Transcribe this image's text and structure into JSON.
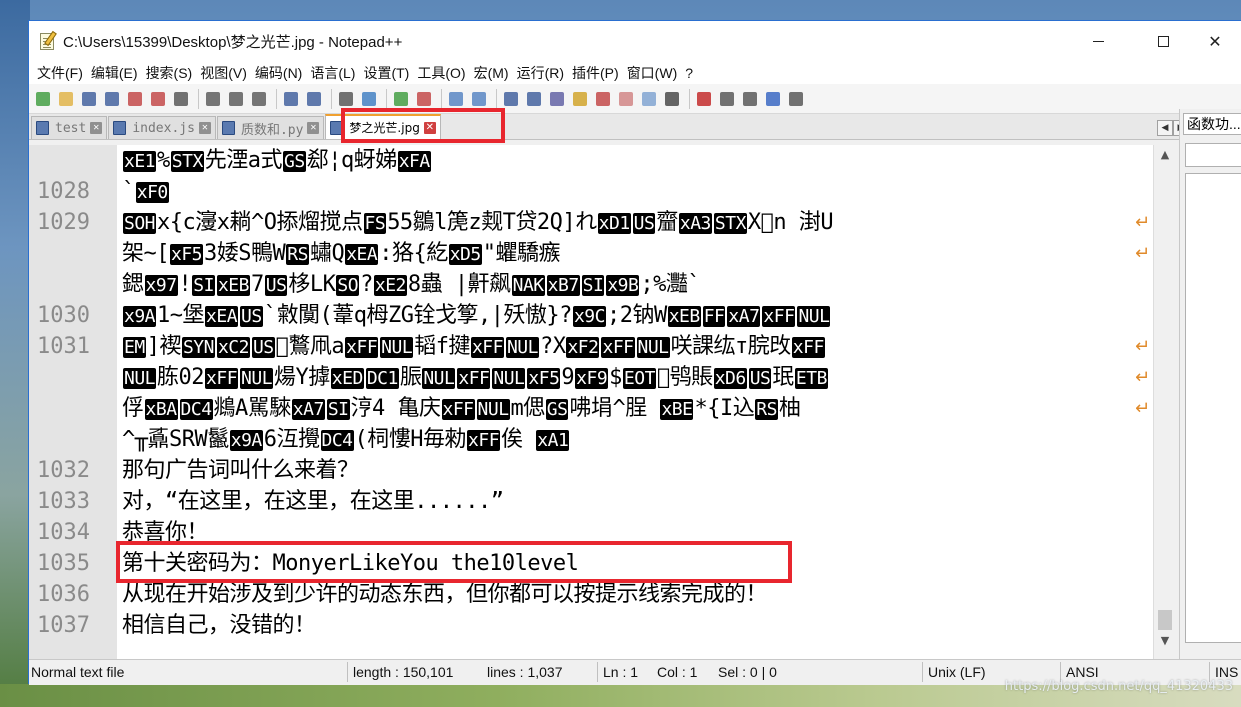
{
  "window": {
    "title": "C:\\Users\\15399\\Desktop\\梦之光芒.jpg - Notepad++",
    "minimize": "—",
    "close": "✕"
  },
  "menu": [
    "文件(F)",
    "编辑(E)",
    "搜索(S)",
    "视图(V)",
    "编码(N)",
    "语言(L)",
    "设置(T)",
    "工具(O)",
    "宏(M)",
    "运行(R)",
    "插件(P)",
    "窗口(W)",
    "?"
  ],
  "toolbar_icons": [
    "new-file-icon",
    "open-file-icon",
    "save-icon",
    "save-all-icon",
    "close-icon",
    "close-all-icon",
    "print-icon",
    "cut-icon",
    "copy-icon",
    "paste-icon",
    "undo-icon",
    "redo-icon",
    "find-icon",
    "replace-icon",
    "zoom-in-icon",
    "zoom-out-icon",
    "sync-v-icon",
    "sync-h-icon",
    "word-wrap-icon",
    "show-all-chars-icon",
    "indent-guide-icon",
    "doc-map-icon",
    "function-list-icon",
    "folder-workspace-icon",
    "doc-list-icon",
    "monitor-icon",
    "record-macro-icon",
    "stop-macro-icon",
    "play-macro-icon",
    "run-multiple-macro-icon",
    "save-macro-icon"
  ],
  "tabs": [
    {
      "label": "test",
      "active": false
    },
    {
      "label": "index.js",
      "active": false
    },
    {
      "label": "质数和.py",
      "active": false
    },
    {
      "label": "梦之光芒.jpg",
      "active": true
    }
  ],
  "side_panel": {
    "title": "函数功..."
  },
  "editor": {
    "rows": [
      {
        "ln": "",
        "segs": [
          [
            "b",
            "xE1"
          ],
          [
            "t",
            "%"
          ],
          [
            "b",
            "STX"
          ],
          [
            "t",
            "先湮a式"
          ],
          [
            "b",
            "GS"
          ],
          [
            "t",
            "郄¦q蚜娣"
          ],
          [
            "b",
            "xFA"
          ]
        ],
        "wrap": false
      },
      {
        "ln": "1028",
        "segs": [
          [
            "t",
            "`"
          ],
          [
            "b",
            "xF0"
          ]
        ],
        "wrap": false
      },
      {
        "ln": "1029",
        "segs": [
          [
            "b",
            "SOH"
          ],
          [
            "t",
            "x{c濅x耥^O掭熘搅点"
          ],
          [
            "b",
            "FS"
          ],
          [
            "t",
            "55鶵l箎z觌T贷2Q]れ"
          ],
          [
            "b",
            "xD1"
          ],
          [
            "b",
            "US"
          ],
          [
            "t",
            "齏"
          ],
          [
            "b",
            "xA3"
          ],
          [
            "b",
            "STX"
          ],
          [
            "t",
            "X\u0000n  湗U"
          ]
        ],
        "wrap": true
      },
      {
        "ln": "",
        "segs": [
          [
            "t",
            "架~["
          ],
          [
            "b",
            "xF5"
          ],
          [
            "t",
            "3婑S鴨W"
          ],
          [
            "b",
            "RS"
          ],
          [
            "t",
            "蟰Q"
          ],
          [
            "b",
            "xEA"
          ],
          [
            "t",
            ":狢{紇"
          ],
          [
            "b",
            "xD5"
          ],
          [
            "t",
            "\"蠷驕瘯"
          ]
        ],
        "wrap": true
      },
      {
        "ln": "",
        "segs": [
          [
            "t",
            "鍶"
          ],
          [
            "b",
            "x97"
          ],
          [
            "t",
            "!"
          ],
          [
            "b",
            "SI"
          ],
          [
            "b",
            "xEB"
          ],
          [
            "t",
            "7"
          ],
          [
            "b",
            "US"
          ],
          [
            "t",
            "栘LK"
          ],
          [
            "b",
            "SO"
          ],
          [
            "t",
            "?"
          ],
          [
            "b",
            "xE2"
          ],
          [
            "t",
            "8蟲  |鼾飙"
          ],
          [
            "b",
            "NAK"
          ],
          [
            "b",
            "xB7"
          ],
          [
            "b",
            "SI"
          ],
          [
            "b",
            "x9B"
          ],
          [
            "t",
            ";%灩`"
          ]
        ],
        "wrap": false
      },
      {
        "ln": "1030",
        "segs": [
          [
            "b",
            "x9A"
          ],
          [
            "t",
            "1~堡"
          ],
          [
            "b",
            "xEA"
          ],
          [
            "b",
            "US"
          ],
          [
            "t",
            "`敹闃(葦q栂ZG铨戈箰,|殀慠}?"
          ],
          [
            "b",
            "x9C"
          ],
          [
            "t",
            ";2钠W"
          ],
          [
            "b",
            "xEB"
          ],
          [
            "b",
            "FF"
          ],
          [
            "b",
            "xA7"
          ],
          [
            "b",
            "xFF"
          ],
          [
            "b",
            "NUL"
          ]
        ],
        "wrap": false
      },
      {
        "ln": "1031",
        "segs": [
          [
            "b",
            "EM"
          ],
          [
            "t",
            "]褉"
          ],
          [
            "b",
            "SYN"
          ],
          [
            "b",
            "xC2"
          ],
          [
            "b",
            "US"
          ],
          [
            "t",
            "\u0000鷘凧a"
          ],
          [
            "b",
            "xFF"
          ],
          [
            "b",
            "NUL"
          ],
          [
            "t",
            "韬f揵"
          ],
          [
            "b",
            "xFF"
          ],
          [
            "b",
            "NUL"
          ],
          [
            "t",
            "?X"
          ],
          [
            "b",
            "xF2"
          ],
          [
            "b",
            "xFF"
          ],
          [
            "b",
            "NUL"
          ],
          [
            "t",
            "咲課纮т脘攺"
          ],
          [
            "b",
            "xFF"
          ]
        ],
        "wrap": true
      },
      {
        "ln": "",
        "segs": [
          [
            "b",
            "NUL"
          ],
          [
            "t",
            "胨02"
          ],
          [
            "b",
            "xFF"
          ],
          [
            "b",
            "NUL"
          ],
          [
            "t",
            "煬Y摢"
          ],
          [
            "b",
            "xED"
          ],
          [
            "b",
            "DC1"
          ],
          [
            "t",
            "脤"
          ],
          [
            "b",
            "NUL"
          ],
          [
            "b",
            "xFF"
          ],
          [
            "b",
            "NUL"
          ],
          [
            "b",
            "xF5"
          ],
          [
            "t",
            "9"
          ],
          [
            "b",
            "xF9"
          ],
          [
            "t",
            "$"
          ],
          [
            "b",
            "EOT"
          ],
          [
            "t",
            "\u0000鸮賬"
          ],
          [
            "b",
            "xD6"
          ],
          [
            "b",
            "US"
          ],
          [
            "t",
            "珉"
          ],
          [
            "b",
            "ETB"
          ]
        ],
        "wrap": true
      },
      {
        "ln": "",
        "segs": [
          [
            "t",
            "俘"
          ],
          [
            "b",
            "xBA"
          ],
          [
            "b",
            "DC4"
          ],
          [
            "t",
            "鴵A駡騋"
          ],
          [
            "b",
            "xA7"
          ],
          [
            "b",
            "SI"
          ],
          [
            "t",
            "涥4  亀庆"
          ],
          [
            "b",
            "xFF"
          ],
          [
            "b",
            "NUL"
          ],
          [
            "t",
            "m偲"
          ],
          [
            "b",
            "GS"
          ],
          [
            "t",
            "咈埍^脭  "
          ],
          [
            "b",
            "xBE"
          ],
          [
            "t",
            "*{I込"
          ],
          [
            "b",
            "RS"
          ],
          [
            "t",
            "柚"
          ]
        ],
        "wrap": true
      },
      {
        "ln": "",
        "segs": [
          [
            "t",
            "^╥鼒SRW鬣"
          ],
          [
            "b",
            "x9A"
          ],
          [
            "t",
            "6沍攪"
          ],
          [
            "b",
            "DC4"
          ],
          [
            "t",
            "(柌慺H毎勑"
          ],
          [
            "b",
            "xFF"
          ],
          [
            "t",
            "俟     "
          ],
          [
            "b",
            "xA1"
          ]
        ],
        "wrap": false
      },
      {
        "ln": "1032",
        "segs": [
          [
            "t",
            "那句广告词叫什么来着？"
          ]
        ],
        "wrap": false
      },
      {
        "ln": "1033",
        "segs": [
          [
            "t",
            "对，“在这里，在这里，在这里......”"
          ]
        ],
        "wrap": false
      },
      {
        "ln": "1034",
        "segs": [
          [
            "t",
            "恭喜你！"
          ]
        ],
        "wrap": false
      },
      {
        "ln": "1035",
        "segs": [
          [
            "t",
            "第十关密码为：MonyerLikeYou the10level"
          ]
        ],
        "wrap": false
      },
      {
        "ln": "1036",
        "segs": [
          [
            "t",
            "从现在开始涉及到少许的动态东西，但你都可以按提示线索完成的！"
          ]
        ],
        "wrap": false
      },
      {
        "ln": "1037",
        "segs": [
          [
            "t",
            "相信自己，没错的！"
          ]
        ],
        "wrap": false
      }
    ]
  },
  "status": {
    "type": "Normal text file",
    "length": "length : 150,101",
    "lines": "lines : 1,037",
    "ln": "Ln : 1",
    "col": "Col : 1",
    "sel": "Sel : 0 | 0",
    "eol": "Unix (LF)",
    "encoding": "ANSI",
    "mode": "INS"
  },
  "watermark": "https://blog.csdn.net/qq_41320433"
}
